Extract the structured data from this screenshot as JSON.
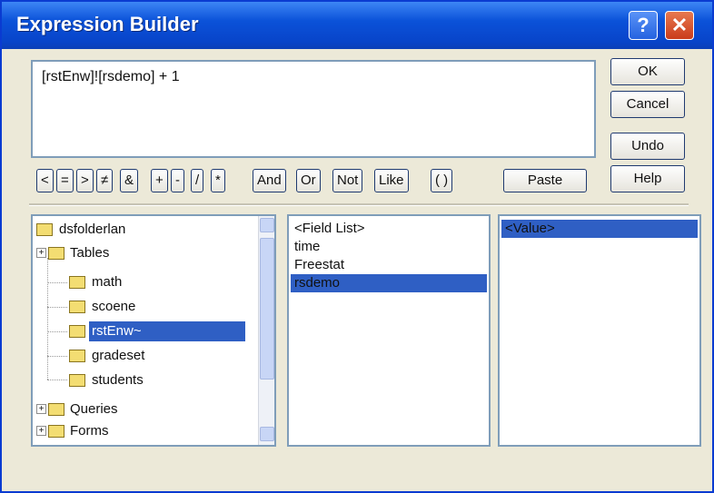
{
  "window": {
    "title": "Expression Builder",
    "help_glyph": "?",
    "close_glyph": "✕"
  },
  "expression": {
    "value": "[rstEnw]![rsdemo] + 1"
  },
  "side_buttons": {
    "ok": "OK",
    "cancel": "Cancel",
    "undo": "Undo",
    "help": "Help"
  },
  "operators": [
    "<",
    "=",
    ">",
    "≠",
    "&",
    "+",
    "-",
    "/",
    "*",
    "And",
    "Or",
    "Not",
    "Like",
    "( )"
  ],
  "paste_label": "Paste",
  "tree": {
    "items": [
      {
        "label": "dsfolderlan",
        "icon": "folder-icon"
      },
      {
        "label": "Tables",
        "icon": "folder-icon",
        "expander": "+"
      },
      {
        "label": "math",
        "icon": "folder-icon"
      },
      {
        "label": "scoene",
        "icon": "folder-icon"
      },
      {
        "label": "rstEnw~",
        "icon": "folder-icon",
        "selected": true
      },
      {
        "label": "gradeset",
        "icon": "folder-icon"
      },
      {
        "label": "students",
        "icon": "folder-icon"
      },
      {
        "label": "Queries",
        "icon": "folder-icon",
        "expander": "+"
      },
      {
        "label": "Forms",
        "icon": "folder-icon",
        "expander": "+"
      }
    ]
  },
  "fields": {
    "items": [
      {
        "label": "<Field List>"
      },
      {
        "label": "time"
      },
      {
        "label": "Freestat"
      },
      {
        "label": "rsdemo",
        "selected": true
      }
    ]
  },
  "values": {
    "items": [
      {
        "label": "<Value>",
        "selected": true
      }
    ]
  }
}
